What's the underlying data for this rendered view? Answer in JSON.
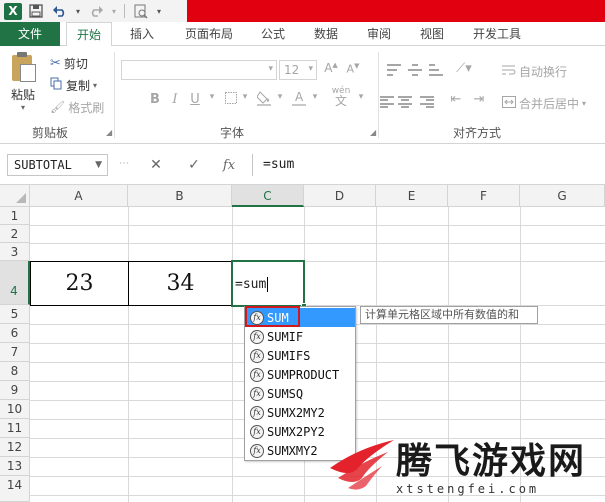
{
  "titlebar": {
    "app_icon": "excel-logo-icon",
    "app_letter": "X",
    "quick_access": [
      "save-icon",
      "undo-icon",
      "redo-icon",
      "print-preview-icon",
      "customize-qat-icon"
    ]
  },
  "ribbon_tabs": [
    {
      "label": "文件"
    },
    {
      "label": "开始"
    },
    {
      "label": "插入"
    },
    {
      "label": "页面布局"
    },
    {
      "label": "公式"
    },
    {
      "label": "数据"
    },
    {
      "label": "审阅"
    },
    {
      "label": "视图"
    },
    {
      "label": "开发工具"
    }
  ],
  "ribbon": {
    "clipboard": {
      "paste": "粘贴",
      "cut": "剪切",
      "copy": "复制",
      "format_painter": "格式刷",
      "group_label": "剪贴板"
    },
    "font": {
      "font_name": "",
      "font_size": "12",
      "bold": "B",
      "italic": "I",
      "underline": "U",
      "phonetic": "wén",
      "group_label": "字体"
    },
    "alignment": {
      "wrap_text": "自动换行",
      "merge_center": "合并后居中",
      "group_label": "对齐方式"
    }
  },
  "formula_bar": {
    "name_box": "SUBTOTAL",
    "cancel": "✕",
    "enter": "✓",
    "fx": "fx",
    "content": "=sum"
  },
  "sheet": {
    "columns": [
      "A",
      "B",
      "C",
      "D",
      "E",
      "F",
      "G"
    ],
    "selected_column": "C",
    "rows": [
      "1",
      "2",
      "3",
      "4",
      "5",
      "6",
      "7",
      "8",
      "9",
      "10",
      "11",
      "12",
      "13",
      "14"
    ],
    "selected_row": "4",
    "cells": {
      "A4": "23",
      "B4": "34",
      "C4": "=sum"
    }
  },
  "autocomplete": {
    "items": [
      "SUM",
      "SUMIF",
      "SUMIFS",
      "SUMPRODUCT",
      "SUMSQ",
      "SUMX2MY2",
      "SUMX2PY2",
      "SUMXMY2"
    ],
    "selected_index": 0,
    "tooltip": "计算单元格区域中所有数值的和"
  },
  "watermark": {
    "title": "腾飞游戏网",
    "subtitle": "xtstengfei.com"
  },
  "colors": {
    "excel_green": "#217346",
    "title_red": "#e00010",
    "selection_blue": "#3399ff",
    "highlight_red": "#d0181f"
  }
}
